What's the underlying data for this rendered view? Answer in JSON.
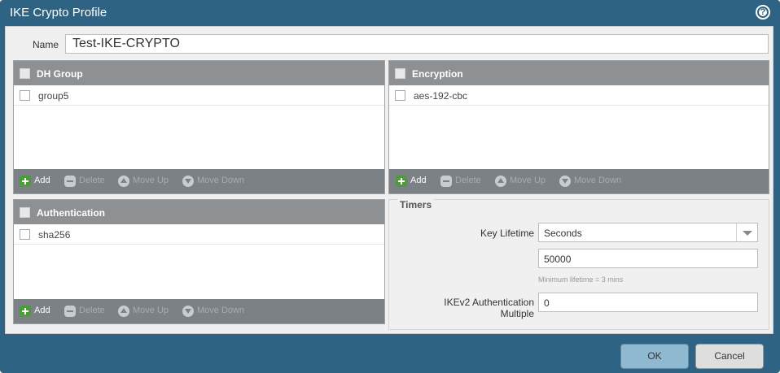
{
  "dialog": {
    "title": "IKE Crypto Profile",
    "help_glyph": "?"
  },
  "name_field": {
    "label": "Name",
    "value": "Test-IKE-CRYPTO"
  },
  "dh_group": {
    "header": "DH Group",
    "rows": [
      "group5"
    ]
  },
  "encryption": {
    "header": "Encryption",
    "rows": [
      "aes-192-cbc"
    ]
  },
  "authentication": {
    "header": "Authentication",
    "rows": [
      "sha256"
    ]
  },
  "toolbar": {
    "add": "Add",
    "delete": "Delete",
    "move_up": "Move Up",
    "move_down": "Move Down"
  },
  "timers": {
    "title": "Timers",
    "key_lifetime_label": "Key Lifetime",
    "key_lifetime_unit": "Seconds",
    "key_lifetime_value": "50000",
    "hint": "Minimum lifetime = 3 mins",
    "ikev2_label_line1": "IKEv2 Authentication",
    "ikev2_label_line2": "Multiple",
    "ikev2_value": "0"
  },
  "footer": {
    "ok": "OK",
    "cancel": "Cancel"
  },
  "colors": {
    "titlebar": "#2e6383",
    "grid_header": "#8d9194",
    "toolbar": "#7c8185",
    "add_icon": "#4f9a3f",
    "ok_button": "#8fb8d1"
  }
}
